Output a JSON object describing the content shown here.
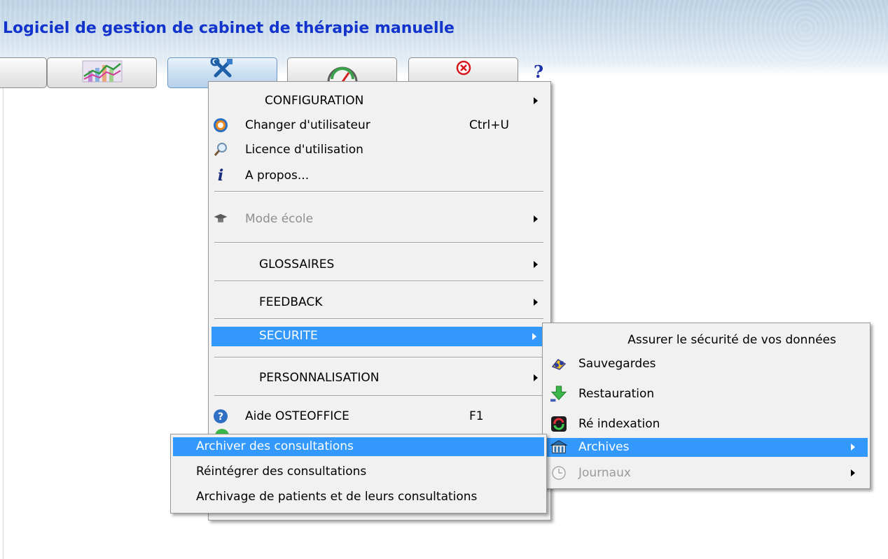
{
  "app": {
    "title": "Logiciel de gestion de cabinet de thérapie manuelle"
  },
  "toolbar": {
    "buttons": [
      {
        "name": "partial-button",
        "icon": "none"
      },
      {
        "name": "statistics-button",
        "icon": "chart-icon"
      },
      {
        "name": "tools-button",
        "icon": "tools-icon",
        "active": true
      },
      {
        "name": "dashboard-button",
        "icon": "gauge-icon"
      },
      {
        "name": "quit-button",
        "icon": "close-circle-icon"
      }
    ],
    "help_label": "?"
  },
  "main_menu": {
    "configuration": "CONFIGURATION",
    "changer_utilisateur": "Changer d'utilisateur",
    "changer_utilisateur_shortcut": "Ctrl+U",
    "licence": "Licence d'utilisation",
    "apropos": "A propos...",
    "mode_ecole": "Mode école",
    "glossaires": "GLOSSAIRES",
    "feedback": "FEEDBACK",
    "securite": "SECURITE",
    "personnalisation": "PERSONNALISATION",
    "aide": "Aide OSTEOFFICE",
    "aide_shortcut": "F1"
  },
  "security_menu": {
    "header": "Assurer le sécurité de vos données",
    "items": [
      {
        "label": "Sauvegardes",
        "icon": "backup-icon"
      },
      {
        "label": "Restauration",
        "icon": "restore-icon"
      },
      {
        "label": "Ré indexation",
        "icon": "reindex-icon"
      },
      {
        "label": "Archives",
        "icon": "archives-icon",
        "selected": true
      },
      {
        "label": "Journaux",
        "icon": "clock-icon",
        "disabled": true
      }
    ]
  },
  "archives_menu": {
    "items": [
      {
        "label": "Archiver des consultations",
        "selected": true
      },
      {
        "label": "Réintégrer des consultations"
      },
      {
        "label": "Archivage de patients et de leurs consultations"
      }
    ]
  },
  "colors": {
    "title": "#1233cc",
    "selection": "#3399ff",
    "menu_bg": "#f1f1f1"
  }
}
